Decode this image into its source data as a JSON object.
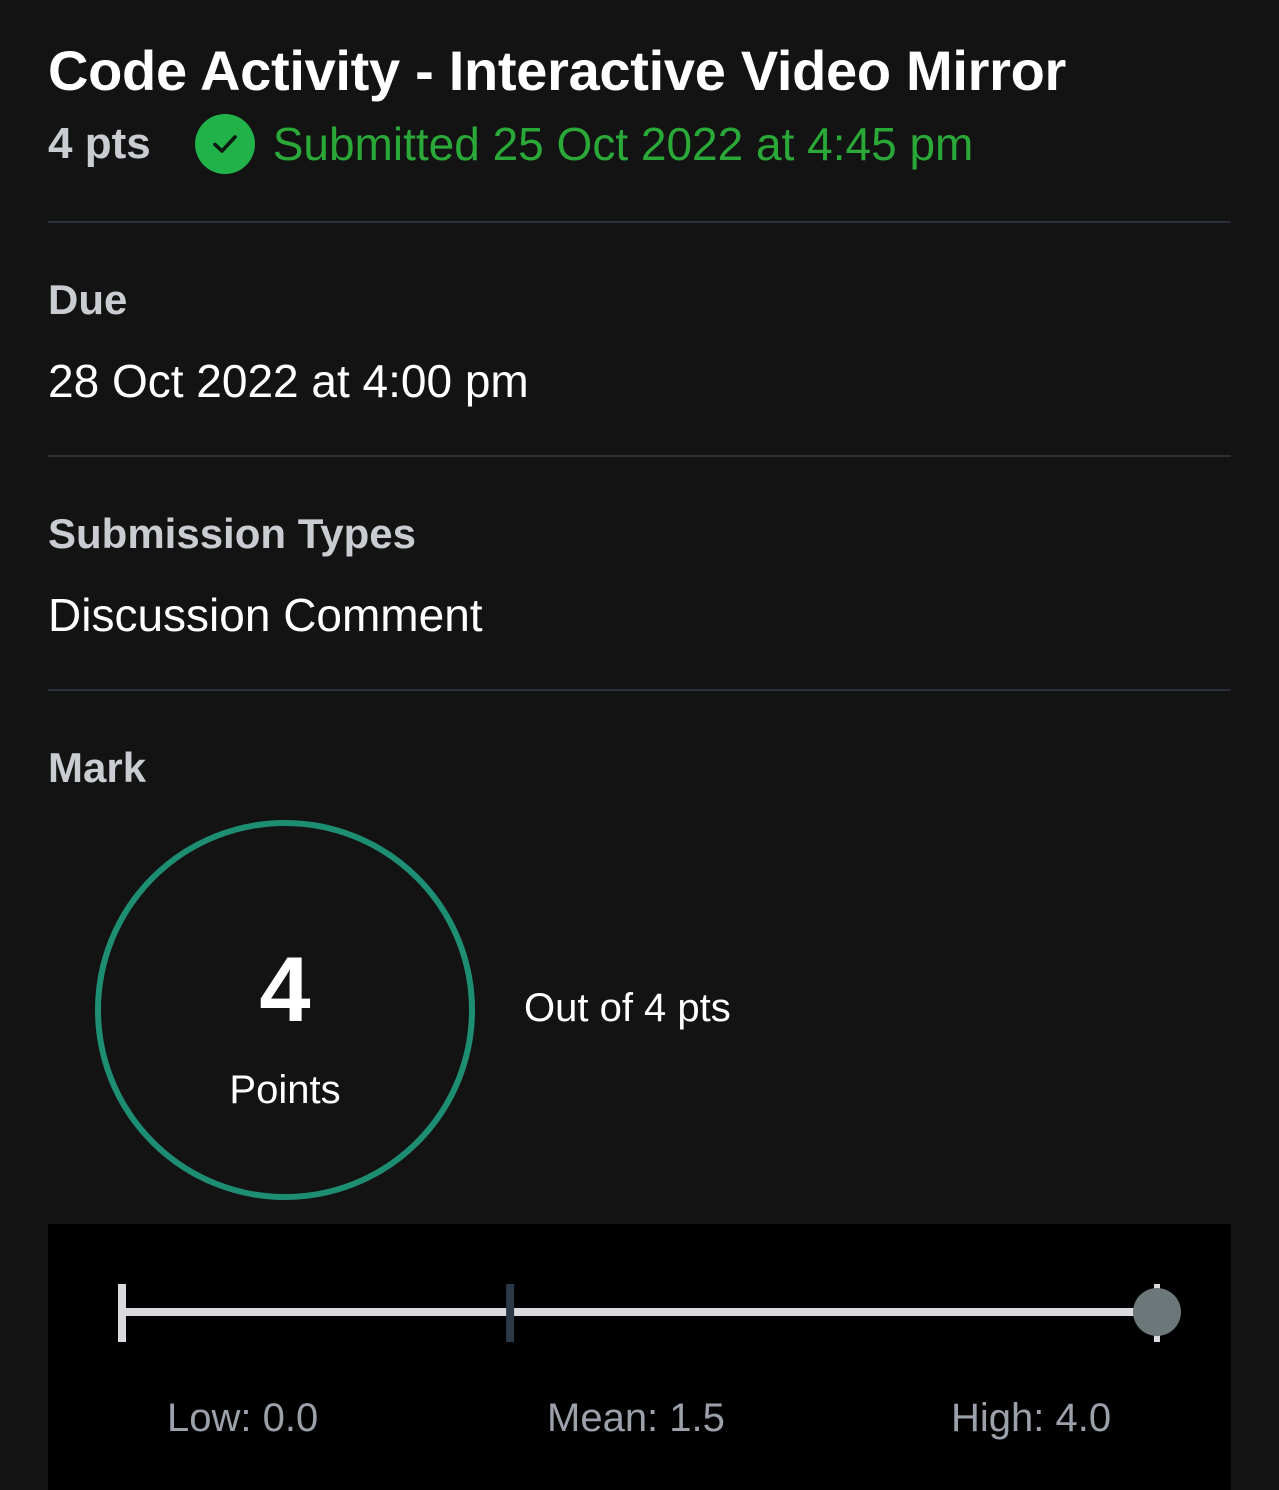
{
  "assignment": {
    "title": "Code Activity - Interactive Video Mirror",
    "points": "4 pts",
    "submitted_status": "Submitted 25 Oct 2022 at 4:45 pm",
    "status_icon": "check-circle-icon",
    "status_color": "#21b24a"
  },
  "due": {
    "label": "Due",
    "value": "28 Oct 2022 at 4:00 pm"
  },
  "submission_types": {
    "label": "Submission Types",
    "value": "Discussion Comment"
  },
  "mark": {
    "label": "Mark",
    "score": "4",
    "unit": "Points",
    "out_of": "Out of 4 pts",
    "ring_color": "#1e8e73"
  },
  "stats": {
    "low_label": "Low: 0.0",
    "mean_label": "Mean: 1.5",
    "high_label": "High: 4.0",
    "low": 0.0,
    "mean": 1.5,
    "high": 4.0,
    "score": 4.0,
    "max": 4.0
  }
}
